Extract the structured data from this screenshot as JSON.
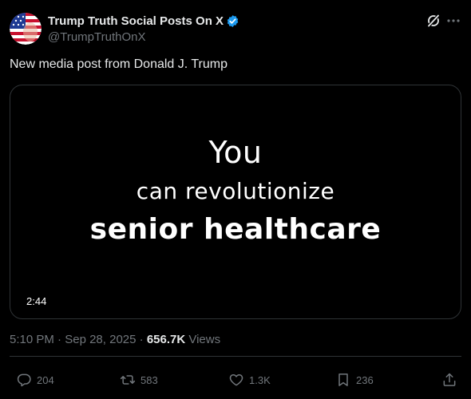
{
  "author": {
    "display_name": "Trump Truth Social Posts On X",
    "handle": "@TrumpTruthOnX",
    "verified": true,
    "verified_color": "#1d9bf0"
  },
  "header_icons": [
    "grok-icon",
    "more-icon"
  ],
  "post": {
    "text": "New media post from Donald J. Trump"
  },
  "media": {
    "type": "video",
    "caption_lines": [
      "You",
      "can revolutionize",
      "senior healthcare"
    ],
    "duration": "2:44"
  },
  "meta": {
    "time": "5:10 PM",
    "separator": "·",
    "date": "Sep 28, 2025",
    "views_count": "656.7K",
    "views_label": "Views"
  },
  "actions": {
    "replies": "204",
    "reposts": "583",
    "likes": "1.3K",
    "bookmarks": "236"
  },
  "colors": {
    "background": "#000000",
    "primary_text": "#e7e9ea",
    "secondary_text": "#71767b",
    "border": "#2f3336",
    "accent": "#1d9bf0"
  }
}
